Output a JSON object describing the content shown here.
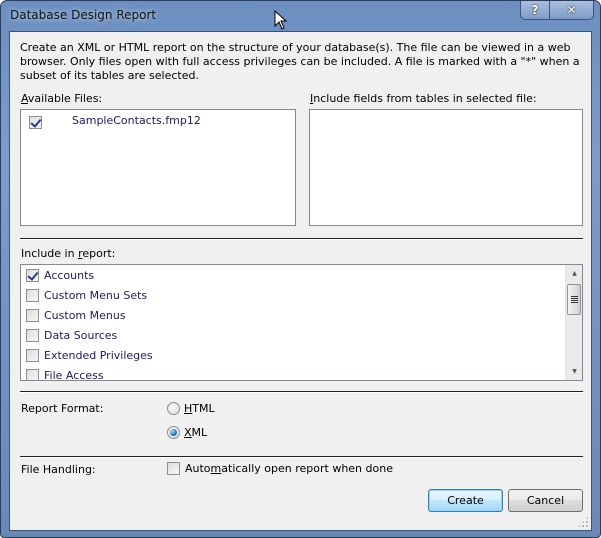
{
  "window": {
    "title": "Database Design Report",
    "help_button": "?",
    "close_button": "✕"
  },
  "description": "Create an XML or HTML report on the structure of your database(s). The file can be viewed in a web browser. Only files open with full access privileges can be included. A file is marked with a \"*\" when a subset of its tables are selected.",
  "available_files": {
    "label_prefix": "A",
    "label_rest": "vailable Files:",
    "files": [
      {
        "name": "SampleContacts.fmp12",
        "checked": true
      }
    ]
  },
  "include_fields": {
    "label_prefix": "I",
    "label_rest": "nclude fields from tables in selected file:"
  },
  "include_in_report": {
    "label_before": "Include in ",
    "label_underlined": "r",
    "label_after": "eport:",
    "items": [
      {
        "label": "Accounts",
        "checked": true
      },
      {
        "label": "Custom Menu Sets",
        "checked": false
      },
      {
        "label": "Custom Menus",
        "checked": false
      },
      {
        "label": "Data Sources",
        "checked": false
      },
      {
        "label": "Extended Privileges",
        "checked": false
      },
      {
        "label": "File Access",
        "checked": false
      }
    ]
  },
  "report_format": {
    "label": "Report Format:",
    "options": [
      {
        "underlined": "H",
        "rest": "TML",
        "selected": false
      },
      {
        "underlined": "X",
        "rest": "ML",
        "selected": true
      }
    ]
  },
  "file_handling": {
    "label": "File Handling:",
    "auto_open": {
      "before": "Auto",
      "underlined": "m",
      "after": "atically open report when done",
      "checked": false
    }
  },
  "buttons": {
    "create": "Create",
    "cancel": "Cancel"
  }
}
